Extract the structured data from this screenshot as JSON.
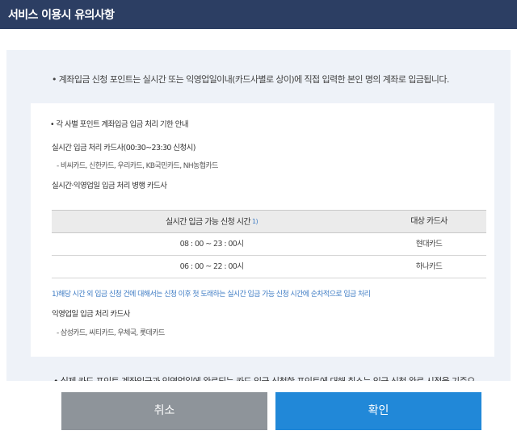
{
  "window": {
    "title": "서비스 이용시 유의사항"
  },
  "notice": "• 계좌입금 신청 포인트는 실시간 또는 익영업일이내(카드사별로 상이)에 직접 입력한 본인 명의 계좌로 입금됩니다.",
  "card": {
    "heading": "• 각 사별 포인트 계좌입금 입금 처리 기한 안내",
    "realtime_label": "실시간 입금 처리 카드사(00:30~23:30 신청시)",
    "realtime_cards": "- 비씨카드, 신한카드, 우리카드, KB국민카드, NH농협카드",
    "parallel_label": "실시간·익영업일 입금 처리 병행 카드사",
    "table": {
      "headers": [
        "실시간 입금 가능 신청 시간",
        "대상 카드사"
      ],
      "header_sup": "1)",
      "rows": [
        {
          "time": "08 : 00 ~ 23 : 00시",
          "company": "현대카드"
        },
        {
          "time": "06 : 00 ~ 22 : 00시",
          "company": "하나카드"
        }
      ]
    },
    "footnote": "1)해당 시간 외 입금 신청 건에 대해서는 신청 이후 첫 도래하는 실시간 입금 가능 신청 시간에 순차적으로 입금 처리",
    "nextday_label": "익영업일 입금 처리 카드사",
    "nextday_cards": "- 삼성카드, 씨티카드, 우체국, 롯데카드"
  },
  "overflow_text": "• 실제 카드 포인트 계좌입금과 익영업일에 완료되는 카드 입금 신청한 포인트에 대해 취소는 입금 신청 완료 시점을 기준으",
  "buttons": {
    "cancel": "취소",
    "confirm": "확인"
  },
  "colors": {
    "titlebar": "#2c3e63",
    "panel": "#eef2f8",
    "cancel": "#8e949a",
    "confirm": "#2188d8",
    "accent": "#3f7cc4"
  }
}
